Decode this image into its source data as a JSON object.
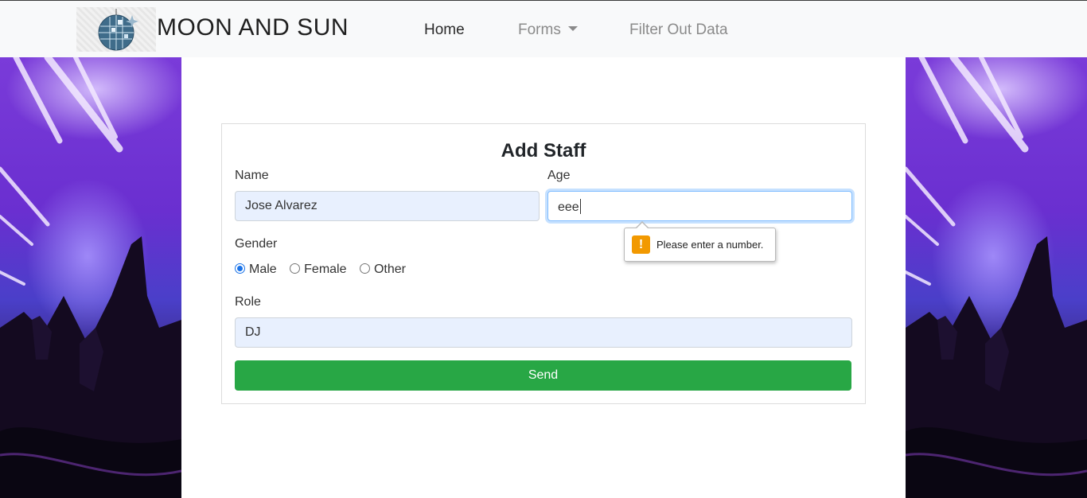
{
  "navbar": {
    "brand": "MOON AND SUN",
    "links": {
      "home": "Home",
      "forms": "Forms",
      "filter": "Filter Out Data"
    }
  },
  "form": {
    "title": "Add Staff",
    "name": {
      "label": "Name",
      "value": "Jose Alvarez"
    },
    "age": {
      "label": "Age",
      "value": "eee"
    },
    "gender": {
      "label": "Gender",
      "options": [
        "Male",
        "Female",
        "Other"
      ],
      "selected": "Male"
    },
    "role": {
      "label": "Role",
      "value": "DJ"
    },
    "submit_label": "Send"
  },
  "validation_tooltip": {
    "message": "Please enter a number.",
    "icon": "warning-icon"
  },
  "colors": {
    "primary_button": "#28a745",
    "focus_ring": "#80bdff",
    "autofill_bg": "#e8f0fe",
    "warning": "#f29900"
  }
}
